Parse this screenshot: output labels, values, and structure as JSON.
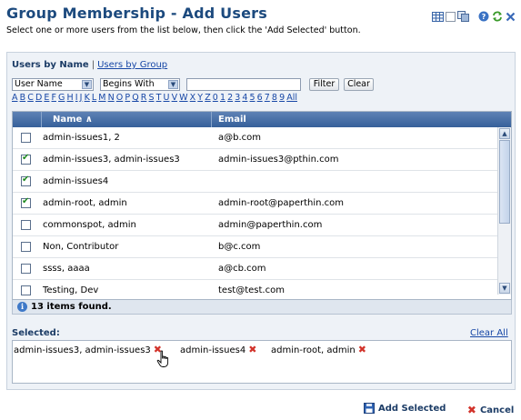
{
  "header": {
    "title": "Group Membership - Add Users",
    "subtitle": "Select one or more users from the list below, then click the 'Add Selected' button.",
    "icons": [
      "grid-view-icon",
      "window-icon",
      "copy-icon",
      "help-icon",
      "refresh-icon",
      "close-icon"
    ]
  },
  "tabs": {
    "by_name": "Users by Name",
    "separator": "|",
    "by_group": "Users by Group"
  },
  "filter": {
    "field_select": "User Name",
    "match_select": "Begins With",
    "text_value": "",
    "filter_button": "Filter",
    "clear_button": "Clear"
  },
  "alphabet": [
    "A",
    "B",
    "C",
    "D",
    "E",
    "F",
    "G",
    "H",
    "I",
    "J",
    "K",
    "L",
    "M",
    "N",
    "O",
    "P",
    "Q",
    "R",
    "S",
    "T",
    "U",
    "V",
    "W",
    "X",
    "Y",
    "Z",
    "0",
    "1",
    "2",
    "3",
    "4",
    "5",
    "6",
    "7",
    "8",
    "9",
    "All"
  ],
  "grid": {
    "columns": [
      "Name ∧",
      "Email"
    ],
    "rows": [
      {
        "name": "admin-issues1, 2",
        "email": "a@b.com",
        "checked": false
      },
      {
        "name": "admin-issues3, admin-issues3",
        "email": "admin-issues3@pthin.com",
        "checked": true
      },
      {
        "name": "admin-issues4",
        "email": "",
        "checked": true
      },
      {
        "name": "admin-root, admin",
        "email": "admin-root@paperthin.com",
        "checked": true
      },
      {
        "name": "commonspot, admin",
        "email": "admin@paperthin.com",
        "checked": false
      },
      {
        "name": "Non, Contributor",
        "email": "b@c.com",
        "checked": false
      },
      {
        "name": "ssss, aaaa",
        "email": "a@cb.com",
        "checked": false
      },
      {
        "name": "Testing, Dev",
        "email": "test@test.com",
        "checked": false
      }
    ],
    "items_found": "13 items found."
  },
  "selected": {
    "label": "Selected:",
    "clear_all": "Clear All",
    "items": [
      "admin-issues3, admin-issues3",
      "admin-issues4",
      "admin-root, admin"
    ]
  },
  "actions": {
    "add_selected": "Add Selected",
    "cancel": "Cancel"
  },
  "colors": {
    "title": "#1c4a7e",
    "grid_header": "#4a70a8",
    "link": "#1747a6",
    "remove": "#d2332b"
  }
}
